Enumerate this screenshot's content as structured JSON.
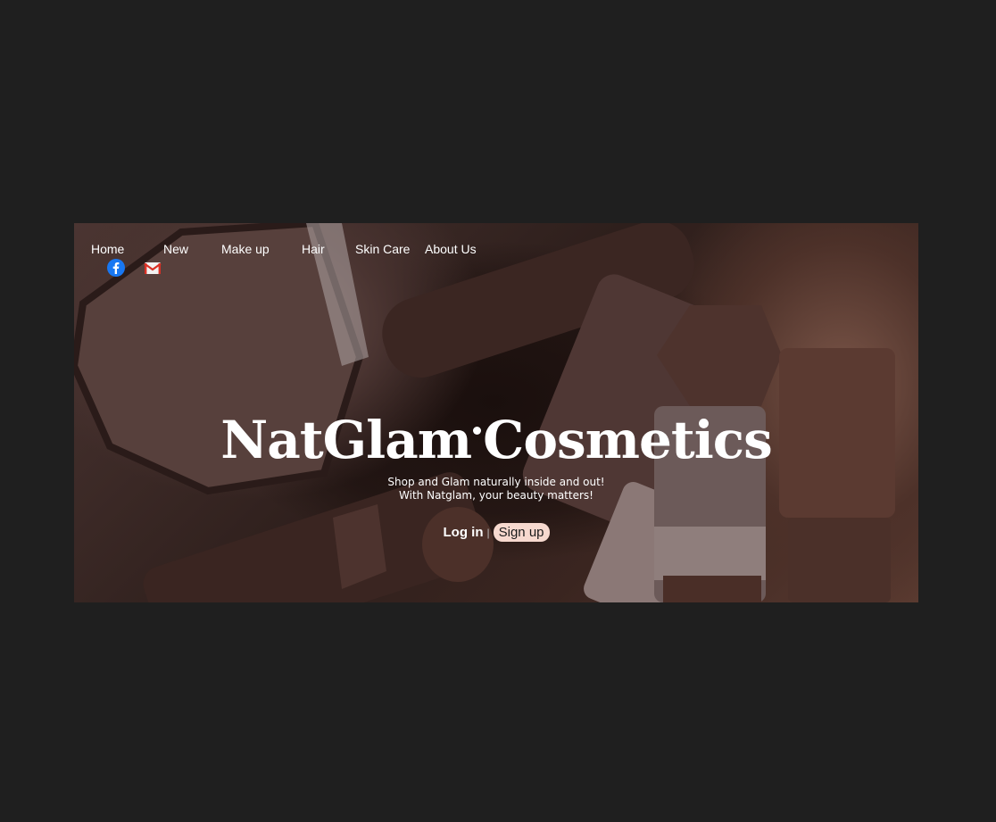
{
  "nav": {
    "items": [
      {
        "label": "Home"
      },
      {
        "label": "New"
      },
      {
        "label": "Make up"
      },
      {
        "label": "Hair"
      },
      {
        "label": "Skin Care"
      },
      {
        "label": "About Us"
      }
    ],
    "social": [
      {
        "icon": "facebook-icon",
        "color": "#1877f2"
      },
      {
        "icon": "gmail-icon",
        "color": "#d93025"
      }
    ]
  },
  "hero": {
    "title_left": "NatGlam",
    "title_right": "Cosmetics",
    "tagline_line1": "Shop and Glam naturally inside and out!",
    "tagline_line2": "With Natglam, your beauty matters!",
    "login_label": "Log in",
    "separator": "|",
    "signup_label": "Sign up"
  },
  "colors": {
    "page_background": "#1f1f1f",
    "signup_background": "#f7d9cf",
    "text": "#ffffff"
  }
}
